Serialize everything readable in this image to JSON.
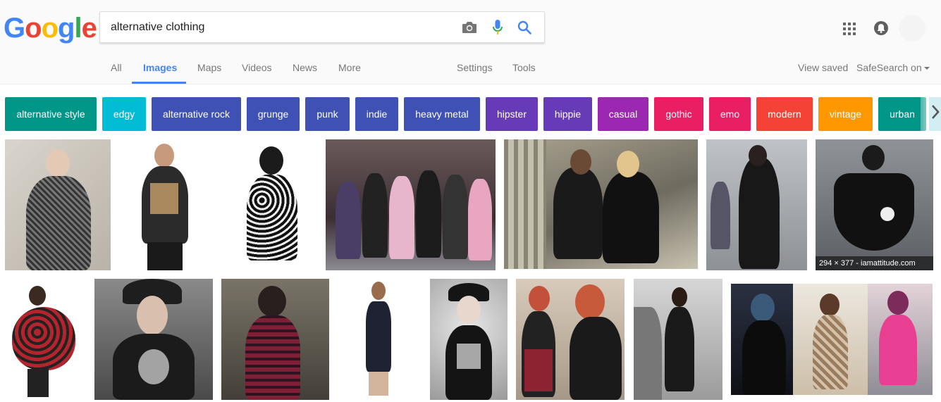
{
  "logo": {
    "letters": [
      "G",
      "o",
      "o",
      "g",
      "l",
      "e"
    ],
    "colors": [
      "#4285f4",
      "#ea4335",
      "#fbbc05",
      "#4285f4",
      "#34a853",
      "#ea4335"
    ]
  },
  "search": {
    "query": "alternative clothing",
    "placeholder": ""
  },
  "tabs": {
    "all": "All",
    "images": "Images",
    "maps": "Maps",
    "videos": "Videos",
    "news": "News",
    "more": "More",
    "settings": "Settings",
    "tools": "Tools"
  },
  "right_links": {
    "view_saved": "View saved",
    "safesearch": "SafeSearch on"
  },
  "chips": [
    {
      "label": "alternative style",
      "color": "#009688"
    },
    {
      "label": "edgy",
      "color": "#00bcd4"
    },
    {
      "label": "alternative rock",
      "color": "#3f51b5"
    },
    {
      "label": "grunge",
      "color": "#3f51b5"
    },
    {
      "label": "punk",
      "color": "#3f51b5"
    },
    {
      "label": "indie",
      "color": "#3f51b5"
    },
    {
      "label": "heavy metal",
      "color": "#3f51b5"
    },
    {
      "label": "hipster",
      "color": "#673ab7"
    },
    {
      "label": "hippie",
      "color": "#673ab7"
    },
    {
      "label": "casual",
      "color": "#9c27b0"
    },
    {
      "label": "gothic",
      "color": "#e91e63"
    },
    {
      "label": "emo",
      "color": "#e91e63"
    },
    {
      "label": "modern",
      "color": "#f44336"
    },
    {
      "label": "vintage",
      "color": "#ff9800"
    },
    {
      "label": "urban",
      "color": "#009688"
    }
  ],
  "hover_caption": "294 × 377 - iamattitude.com",
  "icons": {
    "camera": "camera-icon",
    "mic": "microphone-icon",
    "search": "search-icon",
    "apps": "apps-grid-icon",
    "notifications": "notifications-icon",
    "next": "chevron-right-icon"
  }
}
